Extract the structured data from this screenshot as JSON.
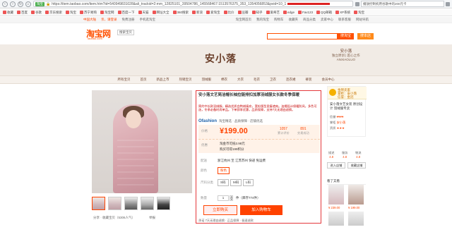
{
  "browser": {
    "url_badge": "淘宝",
    "url": "https://item.taobao.com/item.htm?id=540949831028&ali_trackid=2:mm_12825101_39504786_145568467:1513576375_353_1354056853&pvid=10_1",
    "search_text": "播放控制机用谷歌中的200元卡",
    "bookmarks": [
      "收藏",
      "百度",
      "谷歌",
      "京东搜索",
      "淘宝",
      "苏宁易购",
      "淘宝网",
      "百度一下",
      "天猫",
      "网址大全",
      "360搜索",
      "新浪",
      "爱淘宝",
      "比价",
      "豆瓣",
      "知乎",
      "爱奇艺",
      "edge",
      "Fav123",
      "QQ邮箱",
      "XP系统",
      "淘宝"
    ]
  },
  "topbar": {
    "left": [
      "中国大陆",
      "亲，请登录",
      "免费注册",
      "手机逛淘宝"
    ],
    "right": [
      "淘宝网首页",
      "我的淘宝",
      "购物车",
      "收藏夹",
      "商品分类",
      "卖家中心",
      "联系客服",
      "网站导航"
    ]
  },
  "header": {
    "logo": "淘宝网",
    "logo_sub": "Taobao.com",
    "select": "搜索宝贝",
    "search_btn": "搜淘宝",
    "search_btn2": "搜本店"
  },
  "shop": {
    "name": "安小落",
    "slogan_top": "安小落",
    "slogan_main": "独立原创 | 匠心之作",
    "slogan_sub": "ANXIAOLUO",
    "nav": [
      "所有宝贝",
      "首页",
      "新品上市",
      "热销宝贝",
      "羽绒服",
      "棉衣",
      "大衣",
      "毛衣",
      "卫衣",
      "连衣裙",
      "裤装",
      "会员中心"
    ]
  },
  "product": {
    "title": "安小落文艺简洁帽长袖拉链排扣加厚羽绒服女长款冬季保暖",
    "subtitle": "简约中长款羽绒服，精选优质白鸭绒填充，宽松版型显瘦遮肉。连帽设计保暖防风，多色可选，冬季必备时尚单品。下单即享优惠，品质保障，支持7天无理由退换。",
    "brand_logo": "Ofashion",
    "brand_text": "淘宝精选 · 品质保障 · 店铺优选",
    "price_label": "价格",
    "price": "¥199.00",
    "stat_sales": "1057",
    "stat_sales_label": "累计评价",
    "stat_reviews": "891",
    "stat_reviews_label": "交易成功",
    "promo_label": "优惠",
    "promo_line1": "淘金币可抵3.98元",
    "promo_line2": "购买可得199积分",
    "delivery_label": "配送",
    "delivery_val": "浙江杭州 至 江苏苏州 快递 免运费",
    "color_label": "颜色",
    "color_option": "粉色",
    "size_label": "尺码分类",
    "size_options": [
      "S码",
      "M码",
      "L码"
    ],
    "qty_label": "数量",
    "qty_value": "1",
    "qty_stock": "件（库存774件）",
    "buy_now": "立即购买",
    "add_cart": "加入购物车",
    "pay_label": "承诺",
    "pay_text": "7天无理由退换 · 正品保障 · 极速退款",
    "share_left": "分享 · 收藏宝贝（5306人气）",
    "share_right": "举报"
  },
  "sidebar": {
    "gold_title": "金牌卖家",
    "gold_line2": "掌柜：安小落",
    "gold_line3": "信誉：金冠",
    "shop_title": "安小落文艺女装 原创设计 羽绒服专卖",
    "line_cred": "信誉",
    "line_cred_val": "♥♥♥♥",
    "line_sales": "掌柜",
    "line_sales_val": "安小落",
    "line_zz": "资质",
    "line_zz_val": "★★★",
    "score1_label": "描述",
    "score1": "4.8",
    "score2_label": "服务",
    "score2": "4.8",
    "score3_label": "物流",
    "score3": "4.8",
    "enter_shop": "进入店铺",
    "fav_shop": "收藏店铺",
    "hot_title": "看了又看",
    "hot_price1": "¥ 239.00",
    "hot_price2": "¥ 199.00"
  }
}
